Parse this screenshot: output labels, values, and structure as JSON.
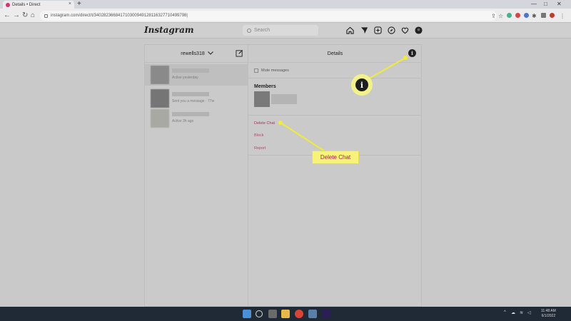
{
  "browser": {
    "tab_title": "Details • Direct",
    "new_tab": "+",
    "url": "instagram.com/direct/t/340282366841710300949128116327710499798|",
    "window_controls": [
      "—",
      "□",
      "✕"
    ]
  },
  "instagram": {
    "logo": "Instagram",
    "search_placeholder": "Search",
    "nav_icons": [
      "home-icon",
      "direct-icon",
      "new-post-icon",
      "explore-icon",
      "activity-heart-icon",
      "profile-icon"
    ]
  },
  "inbox": {
    "username": "rewells318",
    "chevron": "⌄",
    "chats": [
      {
        "meta": "Active yesterday"
      },
      {
        "meta": "Sent you a message · 77w"
      },
      {
        "meta": "Active 3h ago"
      }
    ]
  },
  "details": {
    "title": "Details",
    "mute_label": "Mute messages",
    "members_title": "Members",
    "actions": {
      "delete": "Delete Chat",
      "block": "Block",
      "report": "Report"
    }
  },
  "callouts": {
    "info_icon_glyph": "i",
    "delete_label": "Delete Chat",
    "highlight_color": "#f3f28a",
    "text_color": "#a31e55"
  },
  "taskbar": {
    "clock_time": "11:48 AM",
    "clock_date": "6/1/2022"
  }
}
